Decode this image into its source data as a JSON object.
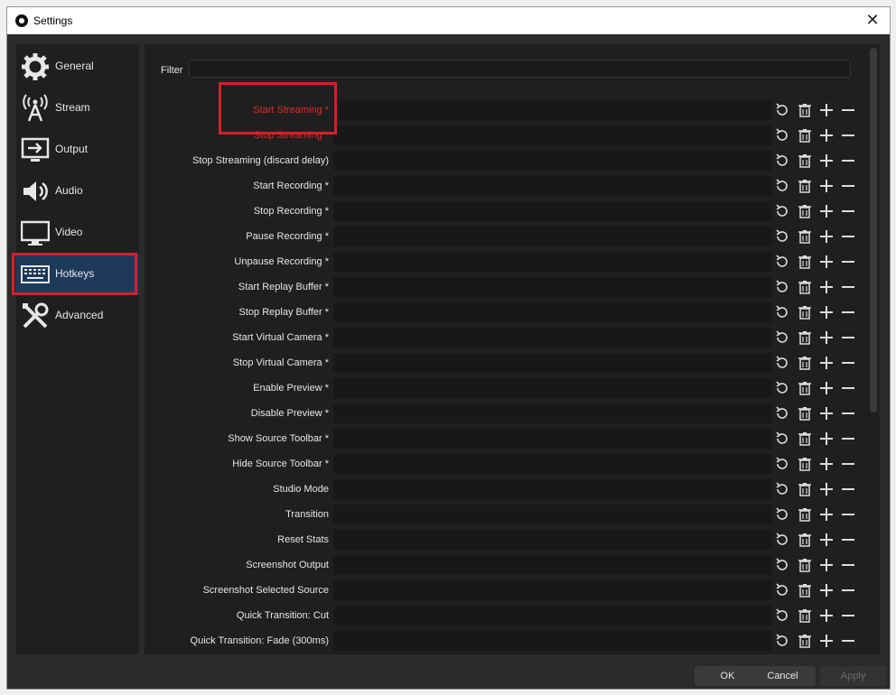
{
  "window": {
    "title": "Settings",
    "close_icon": "close-icon"
  },
  "sidebar": {
    "items": [
      {
        "label": "General",
        "icon": "gear-icon"
      },
      {
        "label": "Stream",
        "icon": "broadcast-icon"
      },
      {
        "label": "Output",
        "icon": "output-icon"
      },
      {
        "label": "Audio",
        "icon": "speaker-icon"
      },
      {
        "label": "Video",
        "icon": "monitor-icon"
      },
      {
        "label": "Hotkeys",
        "icon": "keyboard-icon"
      },
      {
        "label": "Advanced",
        "icon": "tools-icon"
      }
    ],
    "selected": "Hotkeys"
  },
  "hotkeys": {
    "filter_label": "Filter",
    "filter_value": "",
    "rows": [
      {
        "label": "Start Streaming *",
        "highlighted": true
      },
      {
        "label": "Stop Streaming *",
        "highlighted": true
      },
      {
        "label": "Stop Streaming (discard delay)"
      },
      {
        "label": "Start Recording *"
      },
      {
        "label": "Stop Recording *"
      },
      {
        "label": "Pause Recording *"
      },
      {
        "label": "Unpause Recording *"
      },
      {
        "label": "Start Replay Buffer *"
      },
      {
        "label": "Stop Replay Buffer *"
      },
      {
        "label": "Start Virtual Camera *"
      },
      {
        "label": "Stop Virtual Camera *"
      },
      {
        "label": "Enable Preview *"
      },
      {
        "label": "Disable Preview *"
      },
      {
        "label": "Show Source Toolbar *"
      },
      {
        "label": "Hide Source Toolbar *"
      },
      {
        "label": "Studio Mode"
      },
      {
        "label": "Transition"
      },
      {
        "label": "Reset Stats"
      },
      {
        "label": "Screenshot Output"
      },
      {
        "label": "Screenshot Selected Source"
      },
      {
        "label": "Quick Transition: Cut"
      },
      {
        "label": "Quick Transition: Fade (300ms)"
      }
    ],
    "row_actions": [
      "revert-icon",
      "trash-icon",
      "plus-icon",
      "minus-icon"
    ]
  },
  "footer": {
    "ok": "OK",
    "cancel": "Cancel",
    "apply": "Apply"
  },
  "colors": {
    "highlight": "#d3202a",
    "selected_bg": "#1e3a5a",
    "label_red": "#e02a2a"
  }
}
